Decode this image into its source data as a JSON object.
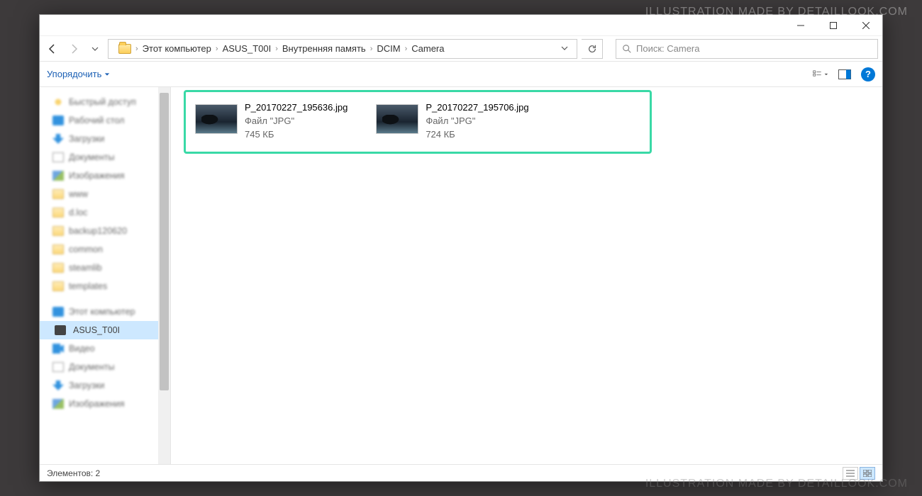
{
  "watermark": "ILLUSTRATION MADE BY DETAILLOOK.COM",
  "breadcrumb": [
    "Этот компьютер",
    "ASUS_T00I",
    "Внутренняя память",
    "DCIM",
    "Camera"
  ],
  "search": {
    "placeholder": "Поиск: Camera"
  },
  "toolbar": {
    "organize": "Упорядочить"
  },
  "sidebar": {
    "items": [
      {
        "label": "Быстрый доступ",
        "icon": "ic-star"
      },
      {
        "label": "Рабочий стол",
        "icon": "ic-desktop"
      },
      {
        "label": "Загрузки",
        "icon": "ic-down"
      },
      {
        "label": "Документы",
        "icon": "ic-doc"
      },
      {
        "label": "Изображения",
        "icon": "ic-img"
      },
      {
        "label": "www",
        "icon": "ic-folder"
      },
      {
        "label": "d.loc",
        "icon": "ic-folder"
      },
      {
        "label": "backup120620",
        "icon": "ic-folder"
      },
      {
        "label": "common",
        "icon": "ic-folder"
      },
      {
        "label": "steamlib",
        "icon": "ic-folder"
      },
      {
        "label": "templates",
        "icon": "ic-folder"
      },
      {
        "label": "Этот компьютер",
        "icon": "ic-pc"
      },
      {
        "label": "ASUS_T00I",
        "icon": "ic-phone",
        "selected": true,
        "clear": true
      },
      {
        "label": "Видео",
        "icon": "ic-video"
      },
      {
        "label": "Документы",
        "icon": "ic-doc"
      },
      {
        "label": "Загрузки",
        "icon": "ic-down"
      },
      {
        "label": "Изображения",
        "icon": "ic-img"
      }
    ]
  },
  "files": [
    {
      "name": "P_20170227_195636.jpg",
      "type": "Файл \"JPG\"",
      "size": "745 КБ"
    },
    {
      "name": "P_20170227_195706.jpg",
      "type": "Файл \"JPG\"",
      "size": "724 КБ"
    }
  ],
  "status": {
    "count_label": "Элементов: 2"
  }
}
